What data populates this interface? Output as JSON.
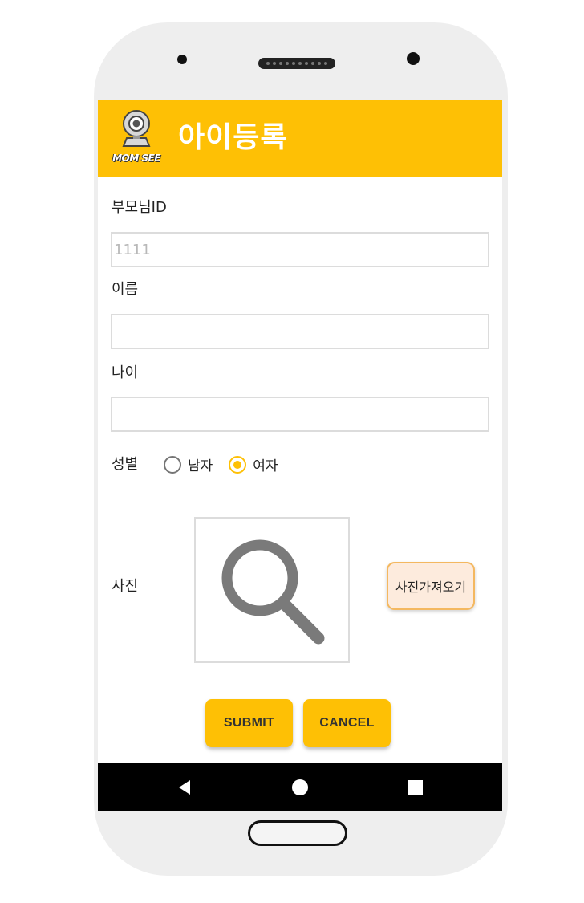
{
  "app": {
    "title": "아이등록",
    "logo_text": "MOM SEE"
  },
  "form": {
    "parent_id_label": "부모님ID",
    "parent_id_placeholder": "1111",
    "parent_id_value": "",
    "name_label": "이름",
    "name_value": "",
    "age_label": "나이",
    "age_value": "",
    "gender_label": "성별",
    "gender_options": [
      {
        "label": "남자",
        "selected": false
      },
      {
        "label": "여자",
        "selected": true
      }
    ],
    "photo_label": "사진",
    "photo_placeholder_icon": "search-icon",
    "load_photo_button": "사진가져오기"
  },
  "actions": {
    "submit_label": "SUBMIT",
    "cancel_label": "CANCEL"
  },
  "navbar": {
    "icons": [
      "back-icon",
      "home-icon",
      "recent-apps-icon"
    ]
  },
  "colors": {
    "accent": "#FEC005",
    "load_button_bg": "#FDEBDD",
    "load_button_border": "#F4B860"
  }
}
